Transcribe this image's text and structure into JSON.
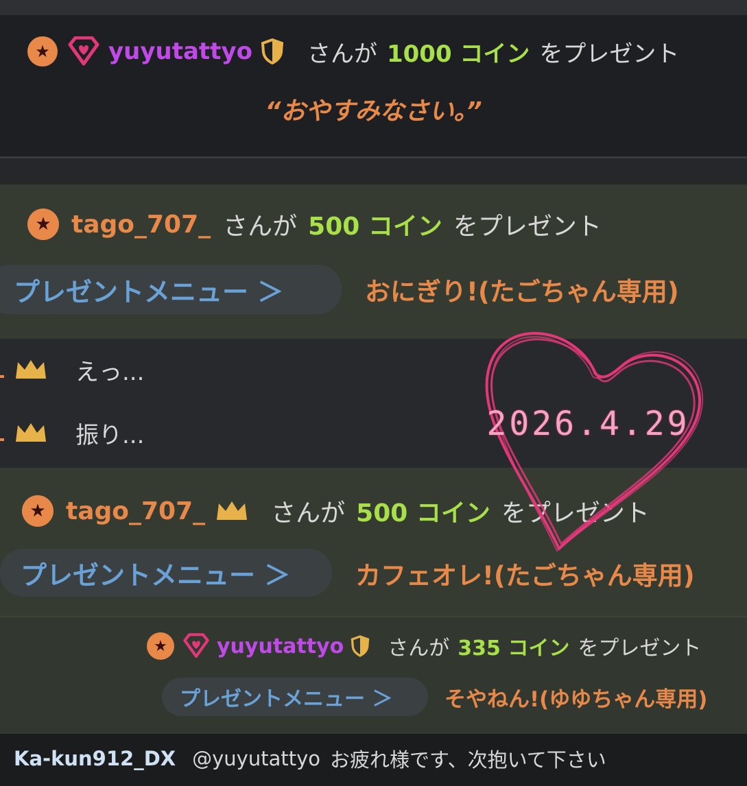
{
  "gifts": [
    {
      "user": "yuyutattyo",
      "text_pre": "さんが",
      "amount": "1000 コイン",
      "text_post": "をプレゼント",
      "message": "“おやすみなさい。”"
    },
    {
      "user": "tago_707_",
      "text_pre": "さんが",
      "amount": "500 コイン",
      "text_post": "をプレゼント",
      "menu_label": "プレゼントメニュー ＞",
      "item": "おにぎり!(たごちゃん専用)"
    },
    {
      "user": "tago_707_",
      "text_pre": "さんが",
      "amount": "500 コイン",
      "text_post": "をプレゼント",
      "menu_label": "プレゼントメニュー ＞",
      "item": "カフェオレ!(たごちゃん専用)"
    },
    {
      "user": "yuyutattyo",
      "text_pre": "さんが",
      "amount": "335 コイン",
      "text_post": "をプレゼント",
      "menu_label": "プレゼントメニュー ＞",
      "item": "そやねん!(ゆゆちゃん専用)"
    }
  ],
  "chat": [
    {
      "text": "えっ..."
    },
    {
      "text": "振り..."
    }
  ],
  "overlay": {
    "date": "2026.4.29"
  },
  "bottom_message": {
    "user": "Ka-kun912_DX",
    "mention": "@yuyutattyo",
    "text": "お疲れ様です、次抱いて下さい"
  },
  "colors": {
    "username_purple": "#c04ae8",
    "username_orange": "#e8894a",
    "coin_green": "#a8e04a",
    "menu_blue": "#6aa2d8",
    "heart_pink": "#e2387a",
    "crown_gold": "#e8b24a"
  },
  "icons": [
    "star-badge-icon",
    "gem-heart-icon",
    "shield-icon",
    "crown-icon",
    "heart-doodle-icon"
  ]
}
